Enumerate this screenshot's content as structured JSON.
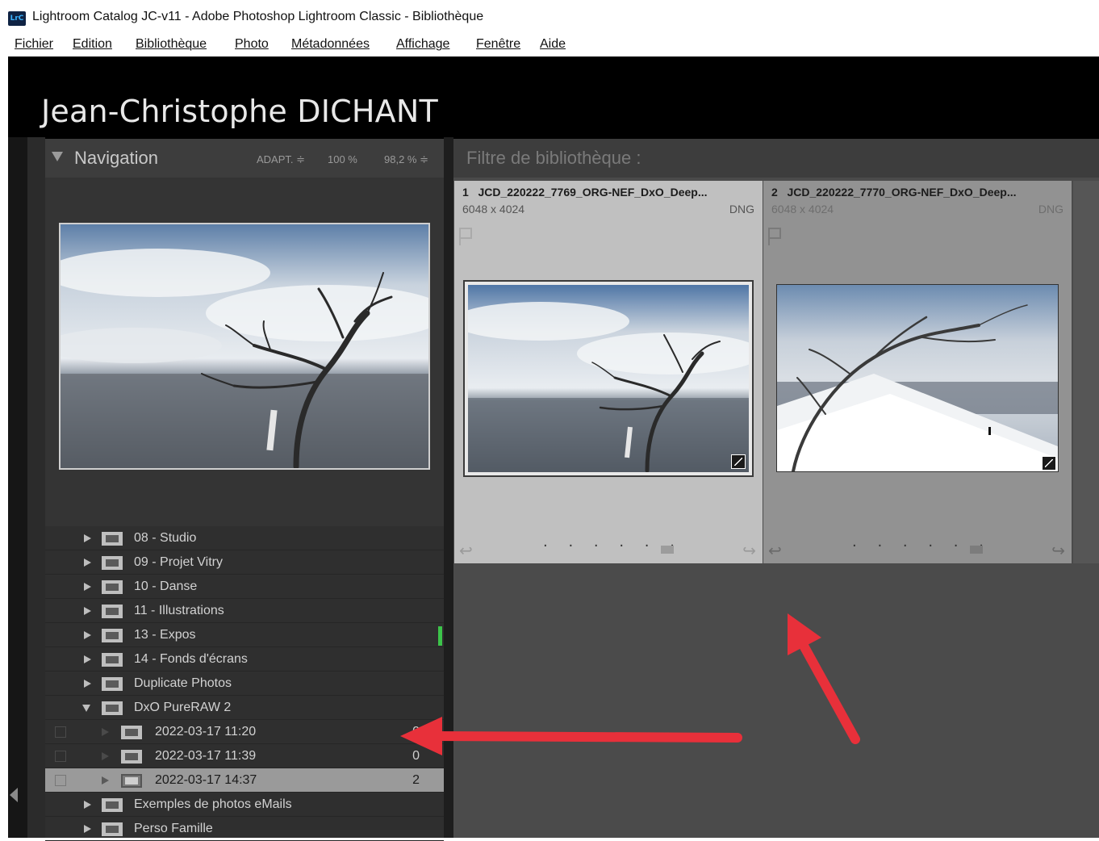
{
  "window": {
    "app_icon_text": "LrC",
    "title": "Lightroom Catalog JC-v11 - Adobe Photoshop Lightroom Classic - Bibliothèque"
  },
  "menu": [
    "Fichier",
    "Edition",
    "Bibliothèque",
    "Photo",
    "Métadonnées",
    "Affichage",
    "Fenêtre",
    "Aide"
  ],
  "identity_plate": "Jean-Christophe DICHANT",
  "navigator": {
    "title": "Navigation",
    "zoom_options": [
      "ADAPT. ≑",
      "100 %",
      "98,2 %  ≑"
    ]
  },
  "folders": [
    {
      "label": "08 - Studio"
    },
    {
      "label": "09 - Projet Vitry"
    },
    {
      "label": "10 - Danse"
    },
    {
      "label": "11 - Illustrations"
    },
    {
      "label": "13 - Expos"
    },
    {
      "label": "14 - Fonds d'écrans"
    },
    {
      "label": "Duplicate Photos"
    },
    {
      "label": "DxO PureRAW 2"
    },
    {
      "label": "2022-03-17 11:20",
      "count": "0"
    },
    {
      "label": "2022-03-17 11:39",
      "count": "0"
    },
    {
      "label": "2022-03-17 14:37",
      "count": "2"
    },
    {
      "label": "Exemples de photos eMails"
    },
    {
      "label": "Perso Famille"
    }
  ],
  "filter_bar": {
    "label": "Filtre de bibliothèque :"
  },
  "grid": [
    {
      "index": "1",
      "filename": "JCD_220222_7769_ORG-NEF_DxO_Deep...",
      "dimensions": "6048 x 4024",
      "type": "DNG"
    },
    {
      "index": "2",
      "filename": "JCD_220222_7770_ORG-NEF_DxO_Deep...",
      "dimensions": "6048 x 4024",
      "type": "DNG"
    }
  ],
  "cell_glyphs": {
    "rotate_left": "↩",
    "rotate_right": "↪",
    "dots": "· · · · · ·"
  },
  "colors": {
    "accent_green": "#3cc44a",
    "annotation_red": "#e8303a",
    "selected_row": "#9a9a9a"
  }
}
